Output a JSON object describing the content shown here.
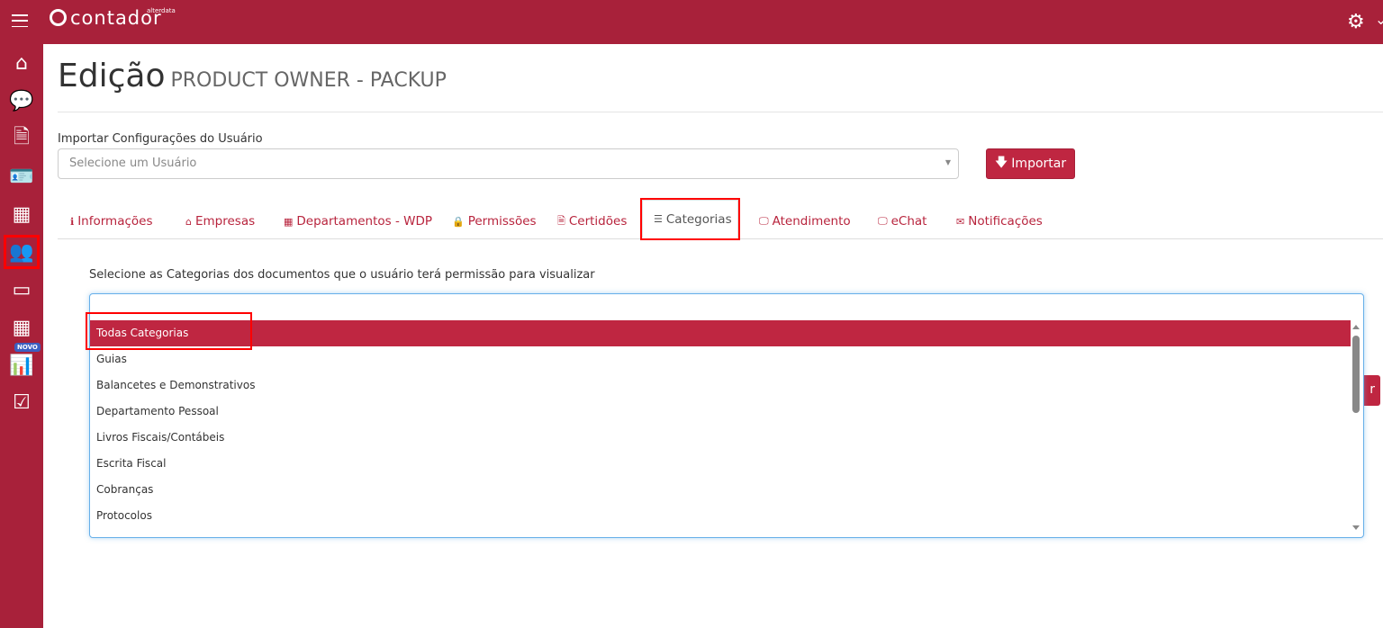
{
  "header": {
    "logo_text": "contador",
    "logo_sub": "alterdata",
    "menu_icon": "hamburger-icon",
    "settings_icon": "gear-icon"
  },
  "sidebar": {
    "items": [
      {
        "icon": "home-icon"
      },
      {
        "icon": "chat-icon"
      },
      {
        "icon": "document-icon"
      },
      {
        "icon": "id-card-icon"
      },
      {
        "icon": "building-icon"
      },
      {
        "icon": "users-icon",
        "active": true
      },
      {
        "icon": "credit-card-icon"
      },
      {
        "icon": "calculator-icon"
      },
      {
        "icon": "bar-chart-icon",
        "badge": "NOVO"
      },
      {
        "icon": "checkbox-icon"
      }
    ]
  },
  "page": {
    "title": "Edição",
    "subtitle": "PRODUCT OWNER - PACKUP"
  },
  "import": {
    "label": "Importar Configurações do Usuário",
    "placeholder": "Selecione um Usuário",
    "button": "Importar"
  },
  "tabs": [
    {
      "label": "Informações"
    },
    {
      "label": "Empresas"
    },
    {
      "label": "Departamentos - WDP"
    },
    {
      "label": "Permissões"
    },
    {
      "label": "Certidões"
    },
    {
      "label": "Categorias",
      "active": true
    },
    {
      "label": "Atendimento"
    },
    {
      "label": "eChat"
    },
    {
      "label": "Notificações"
    }
  ],
  "categorias": {
    "description": "Selecione as Categorias dos documentos que o usuário terá permissão para visualizar",
    "options": [
      "Todas Categorias",
      "Guias",
      "Balancetes e Demonstrativos",
      "Departamento Pessoal",
      "Livros Fiscais/Contábeis",
      "Escrita Fiscal",
      "Cobranças",
      "Protocolos"
    ],
    "selected": "Todas Categorias",
    "hidden_button_fragment": "r"
  },
  "colors": {
    "brand": "#a8213a",
    "accent": "#bf2641"
  }
}
